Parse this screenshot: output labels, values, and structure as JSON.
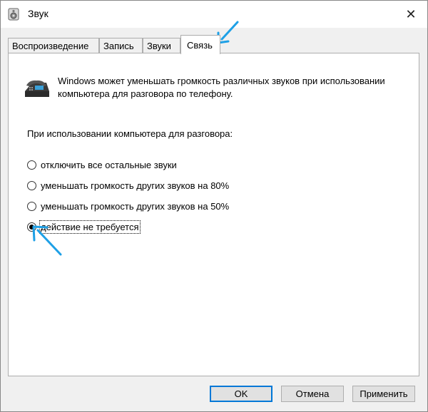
{
  "window": {
    "title": "Звук",
    "close_glyph": "✕"
  },
  "tabs": [
    {
      "label": "Воспроизведение"
    },
    {
      "label": "Запись"
    },
    {
      "label": "Звуки"
    },
    {
      "label": "Связь",
      "active": true
    }
  ],
  "communications": {
    "description": "Windows может уменьшать громкость различных звуков при использовании компьютера для разговора по телефону.",
    "heading": "При использовании компьютера для разговора:",
    "options": [
      {
        "label": "отключить все остальные звуки",
        "checked": false
      },
      {
        "label": "уменьшать громкость других звуков на 80%",
        "checked": false
      },
      {
        "label": "уменьшать громкость других звуков на 50%",
        "checked": false
      },
      {
        "label": "действие не требуется",
        "checked": true
      }
    ]
  },
  "footer": {
    "ok_label": "OK",
    "cancel_label": "Отмена",
    "apply_label": "Применить"
  },
  "colors": {
    "accent": "#0078d7",
    "annotation_arrow": "#1ea0e6"
  },
  "icons": {
    "app": "speaker-icon",
    "phone": "phone-icon",
    "close": "close-icon"
  }
}
